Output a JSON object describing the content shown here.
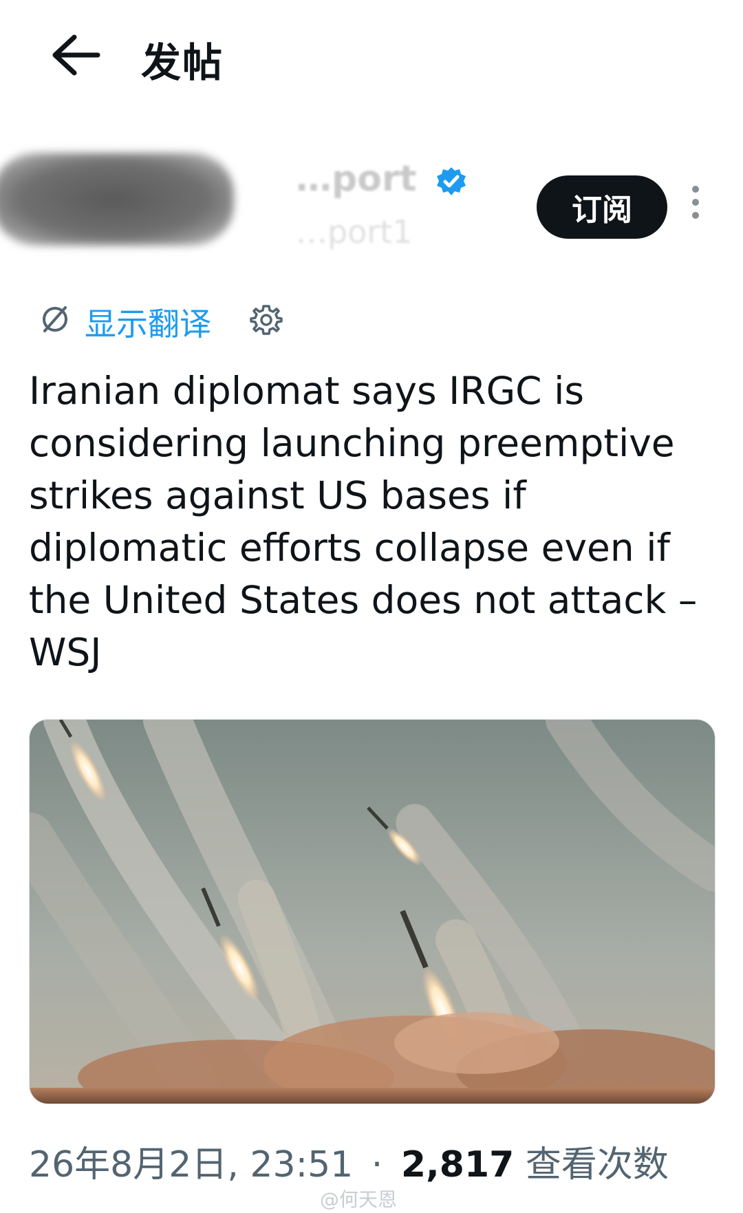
{
  "header": {
    "title": "发帖",
    "back_icon": "arrow-left-icon"
  },
  "author": {
    "display_name": "…port",
    "handle": "…port1",
    "verified_color": "#1d9bf0",
    "subscribe_label": "订阅",
    "more_icon": "more-vertical-icon"
  },
  "translate": {
    "label": "显示翻译",
    "icon": "translate-icon",
    "settings_icon": "gear-icon",
    "color": "#1d9bf0"
  },
  "tweet": {
    "text": "Iranian diplomat says IRGC is considering launching preemptive strikes against US bases if diplomatic efforts collapse even if the United States does not attack – WSJ"
  },
  "media": {
    "description_icon": "photo"
  },
  "meta": {
    "timestamp": "26年8月2日, 23:51",
    "separator": "·",
    "views": "2,817",
    "views_label": "查看次数"
  },
  "watermark": {
    "text": "@何天恩"
  }
}
